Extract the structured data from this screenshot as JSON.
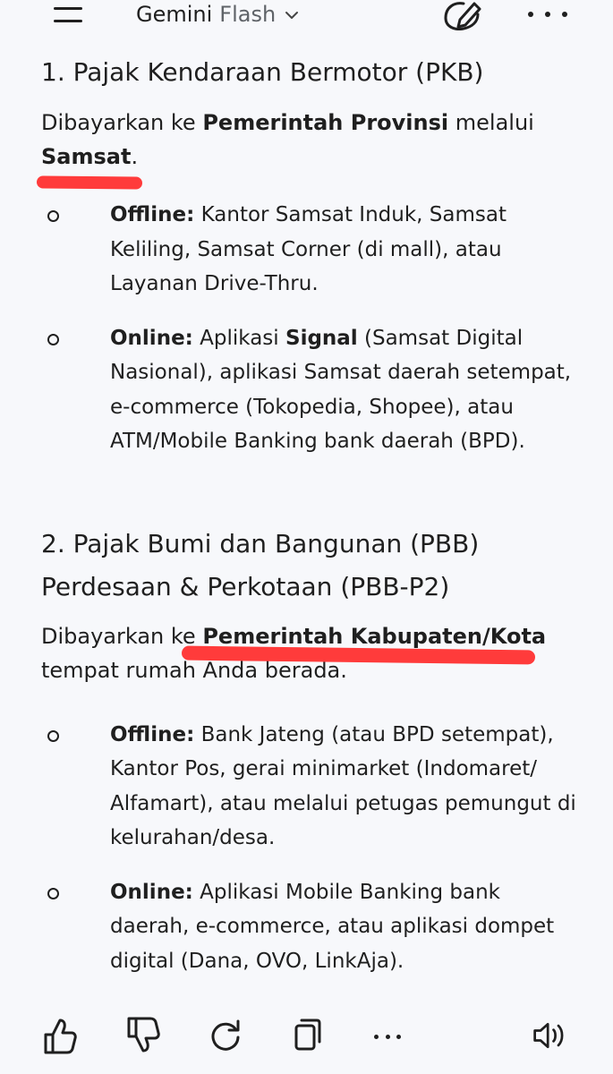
{
  "header": {
    "app_name": "Gemini",
    "model_name": "Flash",
    "icons": [
      "menu-icon",
      "chevron-down-icon",
      "edit-icon",
      "more-options-icon"
    ]
  },
  "sections": [
    {
      "heading": "1. Pajak Kendaraan Bermotor (PKB)",
      "intro_prefix": "Dibayarkan ke ",
      "intro_bold": "Pemerintah Provinsi",
      "intro_middle": " melalui",
      "intro_bold2": "Samsat",
      "intro_suffix": ".",
      "bullets": [
        {
          "label": "Offline:",
          "text": " Kantor Samsat Induk, Samsat Keliling, Samsat Corner (di mall), atau Layanan Drive-Thru."
        },
        {
          "label": "Online:",
          "text_prefix": " Aplikasi ",
          "bold": "Signal",
          "text": " (Samsat Digital Nasional), aplikasi Samsat daerah setempat, e-commerce (Tokopedia, Shopee), atau ATM/Mobile Banking bank daerah (BPD)."
        }
      ]
    },
    {
      "heading_line1": "2. Pajak Bumi dan Bangunan (PBB)",
      "heading_line2": "Perdesaan & Perkotaan (PBB-P2)",
      "intro_prefix": "Dibayarkan ke ",
      "intro_bold": "Pemerintah Kabupaten/Kota",
      "intro_suffix": "tempat rumah Anda berada.",
      "bullets": [
        {
          "label": "Offline:",
          "text": " Bank Jateng (atau BPD setempat), Kantor Pos, gerai minimarket (Indomaret/ Alfamart), atau melalui petugas pemungut di kelurahan/desa."
        },
        {
          "label": "Online:",
          "text": " Aplikasi Mobile Banking bank daerah, e-commerce, atau aplikasi dompet digital (Dana, OVO, LinkAja)."
        }
      ]
    }
  ],
  "actions": [
    "thumbs-up-icon",
    "thumbs-down-icon",
    "regenerate-icon",
    "copy-icon",
    "more-options-icon",
    "read-aloud-icon"
  ],
  "colors": {
    "background": "#f7f8fb",
    "text": "#1f1f1f",
    "highlight_marker": "#ff3b3b"
  }
}
